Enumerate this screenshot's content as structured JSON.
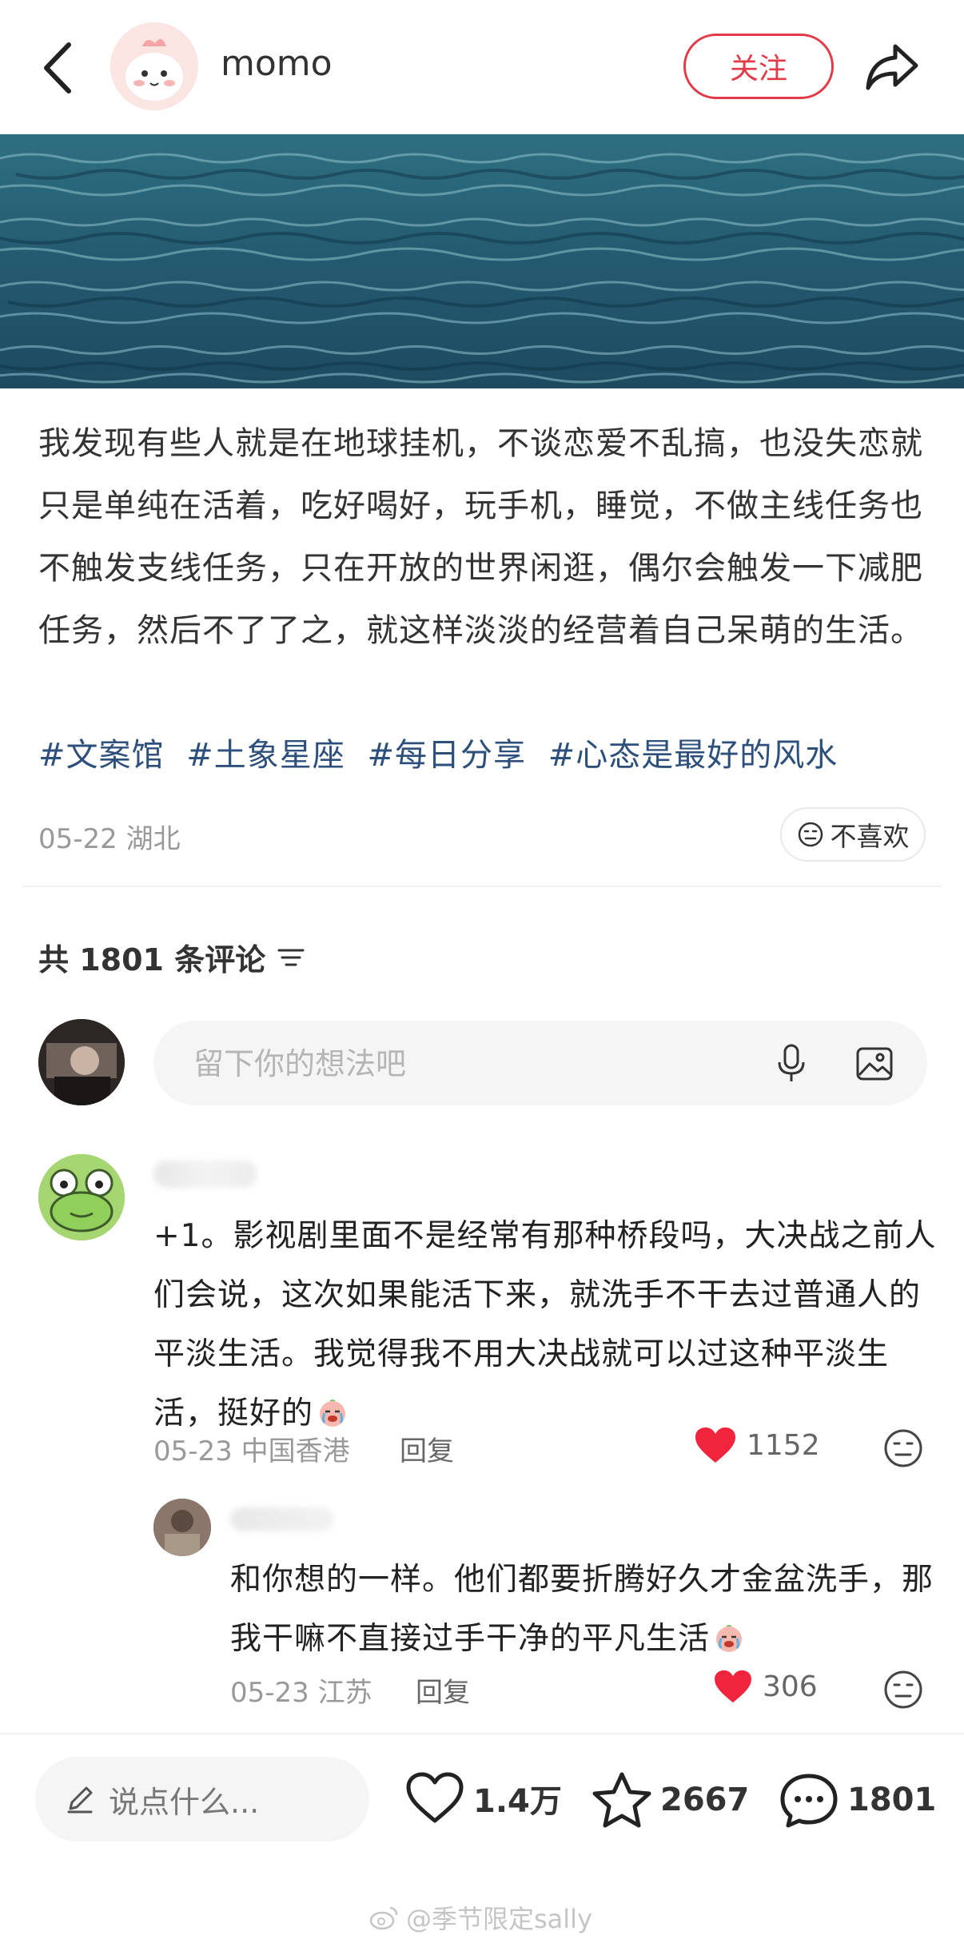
{
  "header": {
    "author_name": "momo",
    "follow_label": "关注"
  },
  "post": {
    "text": "我发现有些人就是在地球挂机，不谈恋爱不乱搞，也没失恋就只是单纯在活着，吃好喝好，玩手机，睡觉，不做主线任务也不触发支线任务，只在开放的世界闲逛，偶尔会触发一下减肥任务，然后不了了之，就这样淡淡的经营着自己呆萌的生活。",
    "tags": [
      "#文案馆",
      "#土象星座",
      "#每日分享",
      "#心态是最好的风水"
    ],
    "date_location": "05-22 湖北",
    "dislike_label": "不喜欢"
  },
  "comments_header": {
    "count_text": "共 1801 条评论"
  },
  "comment_input": {
    "placeholder": "留下你的想法吧"
  },
  "comments": [
    {
      "text": "+1。影视剧里面不是经常有那种桥段吗，大决战之前人们会说，这次如果能活下来，就洗手不干去过普通人的平淡生活。我觉得我不用大决战就可以过这种平淡生活，挺好的",
      "date_location": "05-23 中国香港",
      "reply_label": "回复",
      "likes": "1152"
    },
    {
      "text": "和你想的一样。他们都要折腾好久才金盆洗手，那我干嘛不直接过手干净的平凡生活",
      "date_location": "05-23 江苏",
      "reply_label": "回复",
      "likes": "306"
    }
  ],
  "bottom_bar": {
    "say_placeholder": "说点什么...",
    "likes": "1.4万",
    "favorites": "2667",
    "comments": "1801"
  },
  "watermark": "@季节限定sally",
  "colors": {
    "accent": "#e23a48",
    "tag": "#2d4f7c",
    "like_heart": "#f0253d"
  }
}
